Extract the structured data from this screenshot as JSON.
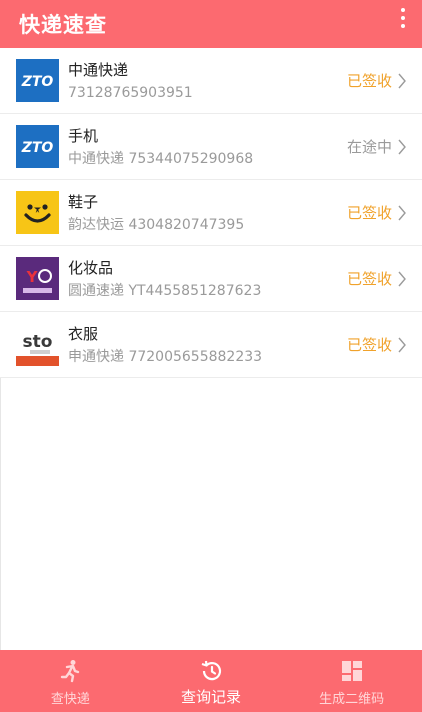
{
  "header": {
    "title": "快递速查"
  },
  "records": [
    {
      "logo": "zto",
      "name": "中通快递",
      "detail": "73128765903951",
      "status": "已签收",
      "status_kind": "signed"
    },
    {
      "logo": "zto",
      "name": "手机",
      "detail": "中通快递 75344075290968",
      "status": "在途中",
      "status_kind": "transit"
    },
    {
      "logo": "yunda",
      "name": "鞋子",
      "detail": "韵达快运 4304820747395",
      "status": "已签收",
      "status_kind": "signed"
    },
    {
      "logo": "yto",
      "name": "化妆品",
      "detail": "圆通速递 YT4455851287623",
      "status": "已签收",
      "status_kind": "signed"
    },
    {
      "logo": "sto",
      "name": "衣服",
      "detail": "申通快递 772005655882233",
      "status": "已签收",
      "status_kind": "signed"
    }
  ],
  "tabs": [
    {
      "label": "查快递",
      "icon": "runner-icon",
      "active": false
    },
    {
      "label": "查询记录",
      "icon": "history-icon",
      "active": true
    },
    {
      "label": "生成二维码",
      "icon": "qr-grid-icon",
      "active": false
    }
  ],
  "colors": {
    "accent": "#fc6a70",
    "signed": "#f0a22b",
    "transit": "#9a9a9a"
  }
}
